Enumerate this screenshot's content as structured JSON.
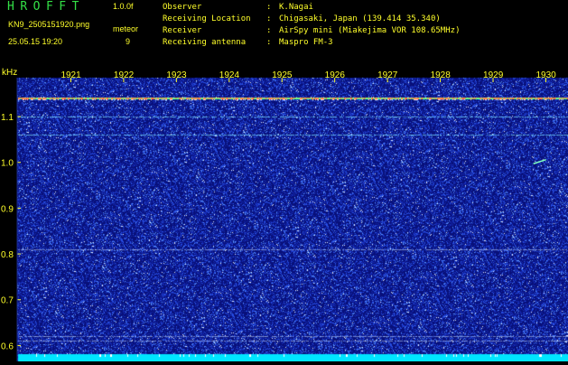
{
  "header": {
    "app_title": "HROFFT",
    "version": "1.0.0f",
    "filename": "KN9_2505151920.png",
    "datetime": "25.05.15 19:20",
    "meteor_label": "meteor",
    "meteor_count": "9",
    "info": [
      {
        "key": "Observer",
        "sep": ":",
        "value": "K.Nagai"
      },
      {
        "key": "Receiving Location",
        "sep": ":",
        "value": "Chigasaki, Japan (139.414 35.340)"
      },
      {
        "key": "Receiver",
        "sep": ":",
        "value": "AirSpy mini (Miakejima VOR 108.65MHz)"
      },
      {
        "key": "Receiving antenna",
        "sep": ":",
        "value": "Maspro FM-3"
      }
    ]
  },
  "chart_data": {
    "type": "heatmap",
    "y_unit": "kHz",
    "x_ticks": [
      "1921",
      "1922",
      "1923",
      "1924",
      "1925",
      "1926",
      "1927",
      "1928",
      "1929",
      "1930"
    ],
    "y_ticks": [
      "1.1",
      "1.0",
      "0.9",
      "0.8",
      "0.7",
      "0.6"
    ],
    "y_range": [
      0.585,
      1.185
    ],
    "x_range_minutes": [
      1920,
      1930.3
    ],
    "carrier_khz": 1.14,
    "faint_lines_khz": [
      1.1,
      1.06,
      0.81,
      0.62,
      0.61
    ],
    "meteor_echoes": [
      {
        "minute": 1929.9,
        "khz_start": 1.006,
        "khz_end": 0.997
      }
    ],
    "colors": {
      "background": "#08107a",
      "noise": "#2e54e8",
      "carrier": "#ffc040",
      "bottom_band": "#00e5ff",
      "axis_text": "#ffff2a"
    }
  }
}
